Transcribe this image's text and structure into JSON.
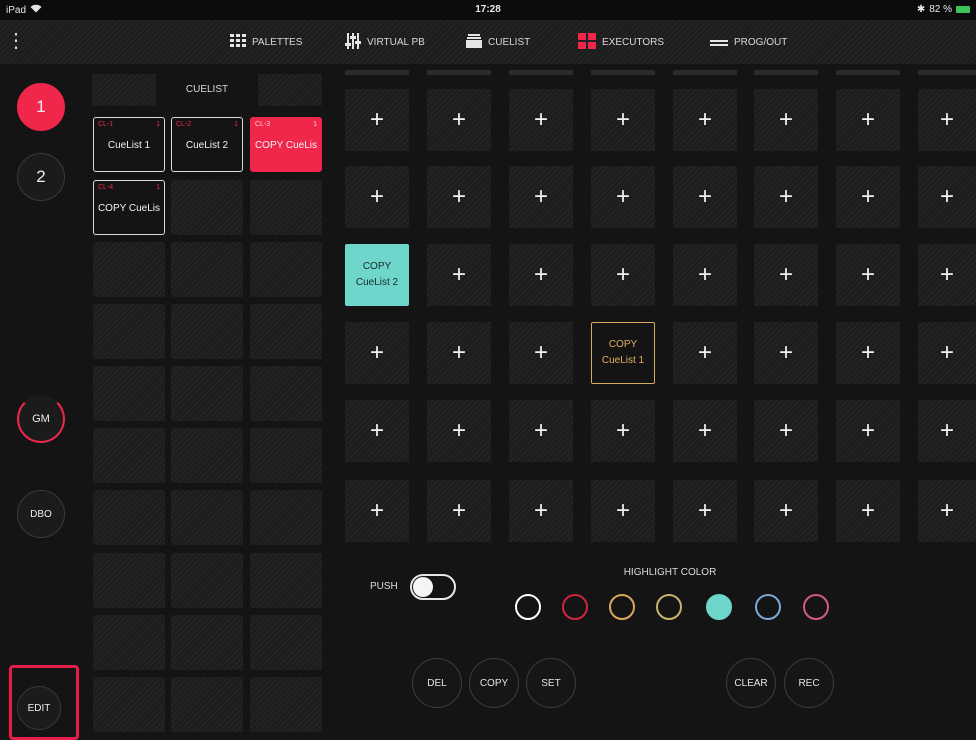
{
  "status_bar": {
    "device": "iPad",
    "wifi_icon": "wifi-icon",
    "time": "17:28",
    "bluetooth": "✱",
    "battery_text": "82 %"
  },
  "nav": {
    "menu_icon": "more-vertical-icon",
    "tabs": [
      {
        "label": "PALETTES",
        "icon": "grid-icon"
      },
      {
        "label": "VIRTUAL PB",
        "icon": "faders-icon"
      },
      {
        "label": "CUELIST",
        "icon": "cuelist-icon"
      },
      {
        "label": "EXECUTORS",
        "icon": "executors-icon",
        "active": true
      },
      {
        "label": "PROG/OUT",
        "icon": "prog-out-icon"
      }
    ]
  },
  "sidebar": {
    "pages": [
      "1",
      "2"
    ],
    "active_page": "1",
    "gm_label": "GM",
    "dbo_label": "DBO",
    "edit_label": "EDIT"
  },
  "cuelist": {
    "title": "CUELIST",
    "cards": [
      {
        "id": "CL-1",
        "num": "1",
        "name": "CueList 1",
        "active": false
      },
      {
        "id": "CL-2",
        "num": "1",
        "name": "CueList 2",
        "active": false
      },
      {
        "id": "CL-3",
        "num": "1",
        "name": "COPY CueLis",
        "active": true
      },
      {
        "id": "CL-4",
        "num": "1",
        "name": "COPY CueLis",
        "active": false
      }
    ]
  },
  "executors": {
    "add_symbol": "+",
    "assigned": [
      {
        "line1": "COPY",
        "line2": "CueList 2",
        "row": 3,
        "col": 1
      },
      {
        "line1": "COPY",
        "line2": "CueList 1",
        "row": 4,
        "col": 4
      }
    ]
  },
  "controls": {
    "push_label": "PUSH",
    "push_on": false,
    "highlight_label": "HIGHLIGHT COLOR",
    "colors": [
      "#ffffff",
      "#d0243f",
      "#d9a85a",
      "#c7b270",
      "#6ed6cb",
      "#7ba9d8",
      "#d9587f"
    ],
    "selected_color": "#6ed6cb",
    "buttons_left": [
      "DEL",
      "COPY",
      "SET"
    ],
    "buttons_right": [
      "CLEAR",
      "REC"
    ]
  }
}
